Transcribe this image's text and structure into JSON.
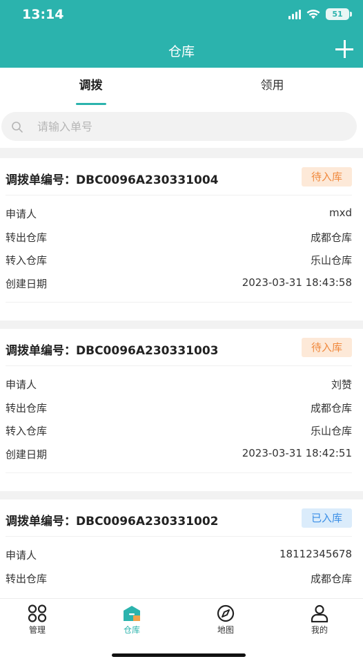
{
  "status_bar": {
    "time": "13:14",
    "battery": "51"
  },
  "header": {
    "title": "仓库"
  },
  "tabs": [
    {
      "label": "调拨",
      "active": true
    },
    {
      "label": "领用",
      "active": false
    }
  ],
  "search": {
    "placeholder": "请输入单号",
    "value": ""
  },
  "colors": {
    "brand": "#2bb3ad",
    "pending": "#f0883c",
    "done": "#3a8ee6"
  },
  "orders": [
    {
      "title": "调拨单编号：DBC0096A230331004",
      "status": "待入库",
      "fields": [
        {
          "label": "申请人",
          "value": "mxd"
        },
        {
          "label": "转出仓库",
          "value": "成都仓库"
        },
        {
          "label": "转入仓库",
          "value": "乐山仓库"
        },
        {
          "label": "创建日期",
          "value": "2023-03-31 18:43:58"
        }
      ]
    },
    {
      "title": "调拨单编号：DBC0096A230331003",
      "status": "待入库",
      "fields": [
        {
          "label": "申请人",
          "value": "刘赞"
        },
        {
          "label": "转出仓库",
          "value": "成都仓库"
        },
        {
          "label": "转入仓库",
          "value": "乐山仓库"
        },
        {
          "label": "创建日期",
          "value": "2023-03-31 18:42:51"
        }
      ]
    },
    {
      "title": "调拨单编号：DBC0096A230331002",
      "status": "已入库",
      "fields": [
        {
          "label": "申请人",
          "value": "18112345678"
        },
        {
          "label": "转出仓库",
          "value": "成都仓库"
        }
      ]
    }
  ],
  "tab_bar": [
    {
      "label": "管理",
      "icon": "grid-icon",
      "active": false
    },
    {
      "label": "仓库",
      "icon": "warehouse-icon",
      "active": true
    },
    {
      "label": "地图",
      "icon": "compass-icon",
      "active": false
    },
    {
      "label": "我的",
      "icon": "user-icon",
      "active": false
    }
  ]
}
